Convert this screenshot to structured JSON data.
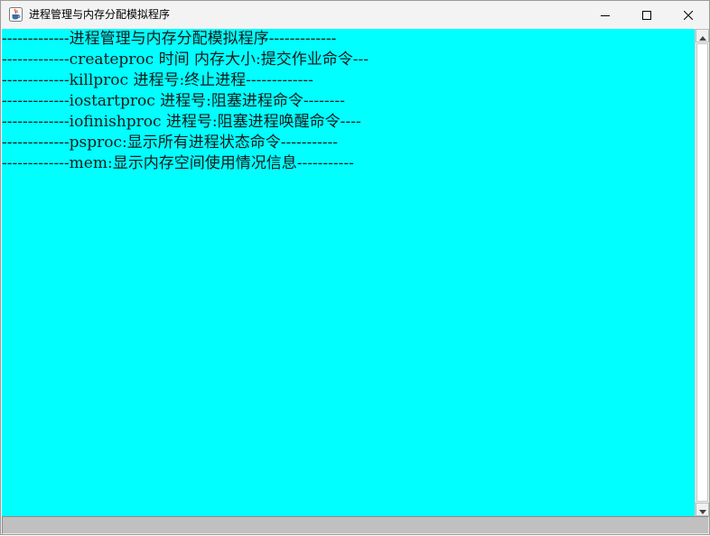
{
  "window": {
    "title": "进程管理与内存分配模拟程序"
  },
  "console": {
    "background": "#00ffff",
    "lines": [
      "-------------进程管理与内存分配模拟程序-------------",
      "-------------createproc 时间 内存大小:提交作业命令---",
      "-------------killproc 进程号:终止进程-------------",
      "-------------iostartproc 进程号:阻塞进程命令--------",
      "-------------iofinishproc 进程号:阻塞进程唤醒命令----",
      "-------------psproc:显示所有进程状态命令-----------",
      "-------------mem:显示内存空间使用情况信息-----------"
    ]
  },
  "command_input": {
    "value": ""
  },
  "icons": {
    "app": "java-cup-icon",
    "minimize": "minimize-icon",
    "maximize": "maximize-icon",
    "close": "close-icon",
    "scroll_up": "chevron-up-icon",
    "scroll_down": "chevron-down-icon"
  }
}
